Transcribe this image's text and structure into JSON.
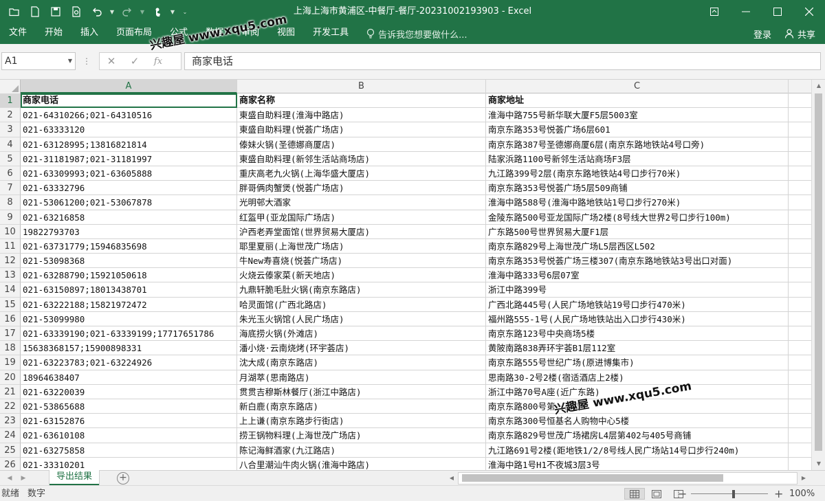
{
  "window": {
    "title": "上海上海市黄浦区-中餐厅-餐厅-20231002193903 - Excel"
  },
  "ribbon": {
    "tabs": [
      "文件",
      "开始",
      "插入",
      "页面布局",
      "公式",
      "数据",
      "审阅",
      "视图",
      "开发工具"
    ],
    "tell_me": "告诉我您想要做什么...",
    "login": "登录",
    "share": "共享"
  },
  "formula_bar": {
    "name_box": "A1",
    "fx": "fx",
    "content": "商家电话"
  },
  "columns": [
    "A",
    "B",
    "C"
  ],
  "rows": [
    {
      "n": "1",
      "a": "商家电话",
      "b": "商家名称",
      "c": "商家地址"
    },
    {
      "n": "2",
      "a": "021-64310266;021-64310516",
      "b": "東盛自助料理(淮海中路店)",
      "c": "淮海中路755号新华联大厦F5层5003室"
    },
    {
      "n": "3",
      "a": "021-63333120",
      "b": "東盛自助料理(悦荟广场店)",
      "c": "南京东路353号悦荟广场6层601"
    },
    {
      "n": "4",
      "a": "021-63128995;13816821814",
      "b": "傣妹火锅(圣德娜商厦店)",
      "c": "南京东路387号圣德娜商厦6层(南京东路地铁站4号口旁)"
    },
    {
      "n": "5",
      "a": "021-31181987;021-31181997",
      "b": "東盛自助料理(新邻生活站商场店)",
      "c": "陆家浜路1100号新邻生活站商场F3层"
    },
    {
      "n": "6",
      "a": "021-63309993;021-63605888",
      "b": "重庆高老九火锅(上海华盛大厦店)",
      "c": "九江路399号2层(南京东路地铁站4号口步行70米)"
    },
    {
      "n": "7",
      "a": "021-63332796",
      "b": "胖哥俩肉蟹煲(悦荟广场店)",
      "c": "南京东路353号悦荟广场5层509商铺"
    },
    {
      "n": "8",
      "a": "021-53061200;021-53067878",
      "b": "光明邨大酒家",
      "c": "淮海中路588号(淮海中路地铁站1号口步行270米)"
    },
    {
      "n": "9",
      "a": "021-63216858",
      "b": "红盔甲(亚龙国际广场店)",
      "c": "金陵东路500号亚龙国际广场2楼(8号线大世界2号口步行100m)"
    },
    {
      "n": "10",
      "a": "19822793703",
      "b": "沪西老弄堂面馆(世界贸易大厦店)",
      "c": "广东路500号世界贸易大厦F1层"
    },
    {
      "n": "11",
      "a": "021-63731779;15946835698",
      "b": "耶里夏丽(上海世茂广场店)",
      "c": "南京东路829号上海世茂广场L5层西区L502"
    },
    {
      "n": "12",
      "a": "021-53098368",
      "b": "牛New寿喜烧(悦荟广场店)",
      "c": "南京东路353号悦荟广场三楼307(南京东路地铁站3号出口对面)"
    },
    {
      "n": "13",
      "a": "021-63288790;15921050618",
      "b": "火烧云傣家菜(新天地店)",
      "c": "淮海中路333号6层07室"
    },
    {
      "n": "14",
      "a": "021-63150897;18013438701",
      "b": "九鼎轩脆毛肚火锅(南京东路店)",
      "c": "浙江中路399号"
    },
    {
      "n": "15",
      "a": "021-63222188;15821972472",
      "b": "哈灵面馆(广西北路店)",
      "c": "广西北路445号(人民广场地铁站19号口步行470米)"
    },
    {
      "n": "16",
      "a": "021-53099980",
      "b": "朱光玉火锅馆(人民广场店)",
      "c": "福州路555-1号(人民广场地铁站出入口步行430米)"
    },
    {
      "n": "17",
      "a": "021-63339190;021-63339199;17717651786",
      "b": "海底捞火锅(外滩店)",
      "c": "南京东路123号中央商场5楼"
    },
    {
      "n": "18",
      "a": "15638368157;15900898331",
      "b": "潘小烧·云南烧烤(环宇荟店)",
      "c": "黄陂南路838弄环宇荟B1层112室"
    },
    {
      "n": "19",
      "a": "021-63223783;021-63224926",
      "b": "沈大成(南京东路店)",
      "c": "南京东路555号世纪广场(原进博集市)"
    },
    {
      "n": "20",
      "a": "18964638407",
      "b": "月湖萃(思南路店)",
      "c": "思南路30-2号2楼(宿适酒店上2楼)"
    },
    {
      "n": "21",
      "a": "021-63220039",
      "b": "贯贯吉穆斯林餐厅(浙江中路店)",
      "c": "浙江中路70号A座(近广东路)"
    },
    {
      "n": "22",
      "a": "021-53865688",
      "b": "新白鹿(南京东路店)",
      "c": "南京东路800号第一百货"
    },
    {
      "n": "23",
      "a": "021-63152876",
      "b": "上上谦(南京东路步行街店)",
      "c": "南京东路300号恒基名人购物中心5楼"
    },
    {
      "n": "24",
      "a": "021-63610108",
      "b": "捞王锅物料理(上海世茂广场店)",
      "c": "南京东路829号世茂广场裙房L4层第402与405号商铺"
    },
    {
      "n": "25",
      "a": "021-63275858",
      "b": "陈记海鲜酒家(九江路店)",
      "c": "九江路691号2楼(距地铁1/2/8号线人民广场站14号口步行240m)"
    },
    {
      "n": "26",
      "a": "021-33310201",
      "b": "八合里潮汕牛肉火锅(淮海中路店)",
      "c": "淮海中路1号H1不夜城3层3号"
    }
  ],
  "sheet": {
    "tab": "导出结果",
    "add": "+"
  },
  "status": {
    "ready": "就绪",
    "mode": "数字",
    "zoom": "100%",
    "minus": "−",
    "plus": "+"
  },
  "watermark": {
    "text": "兴趣屋 www.xqu5.com"
  }
}
